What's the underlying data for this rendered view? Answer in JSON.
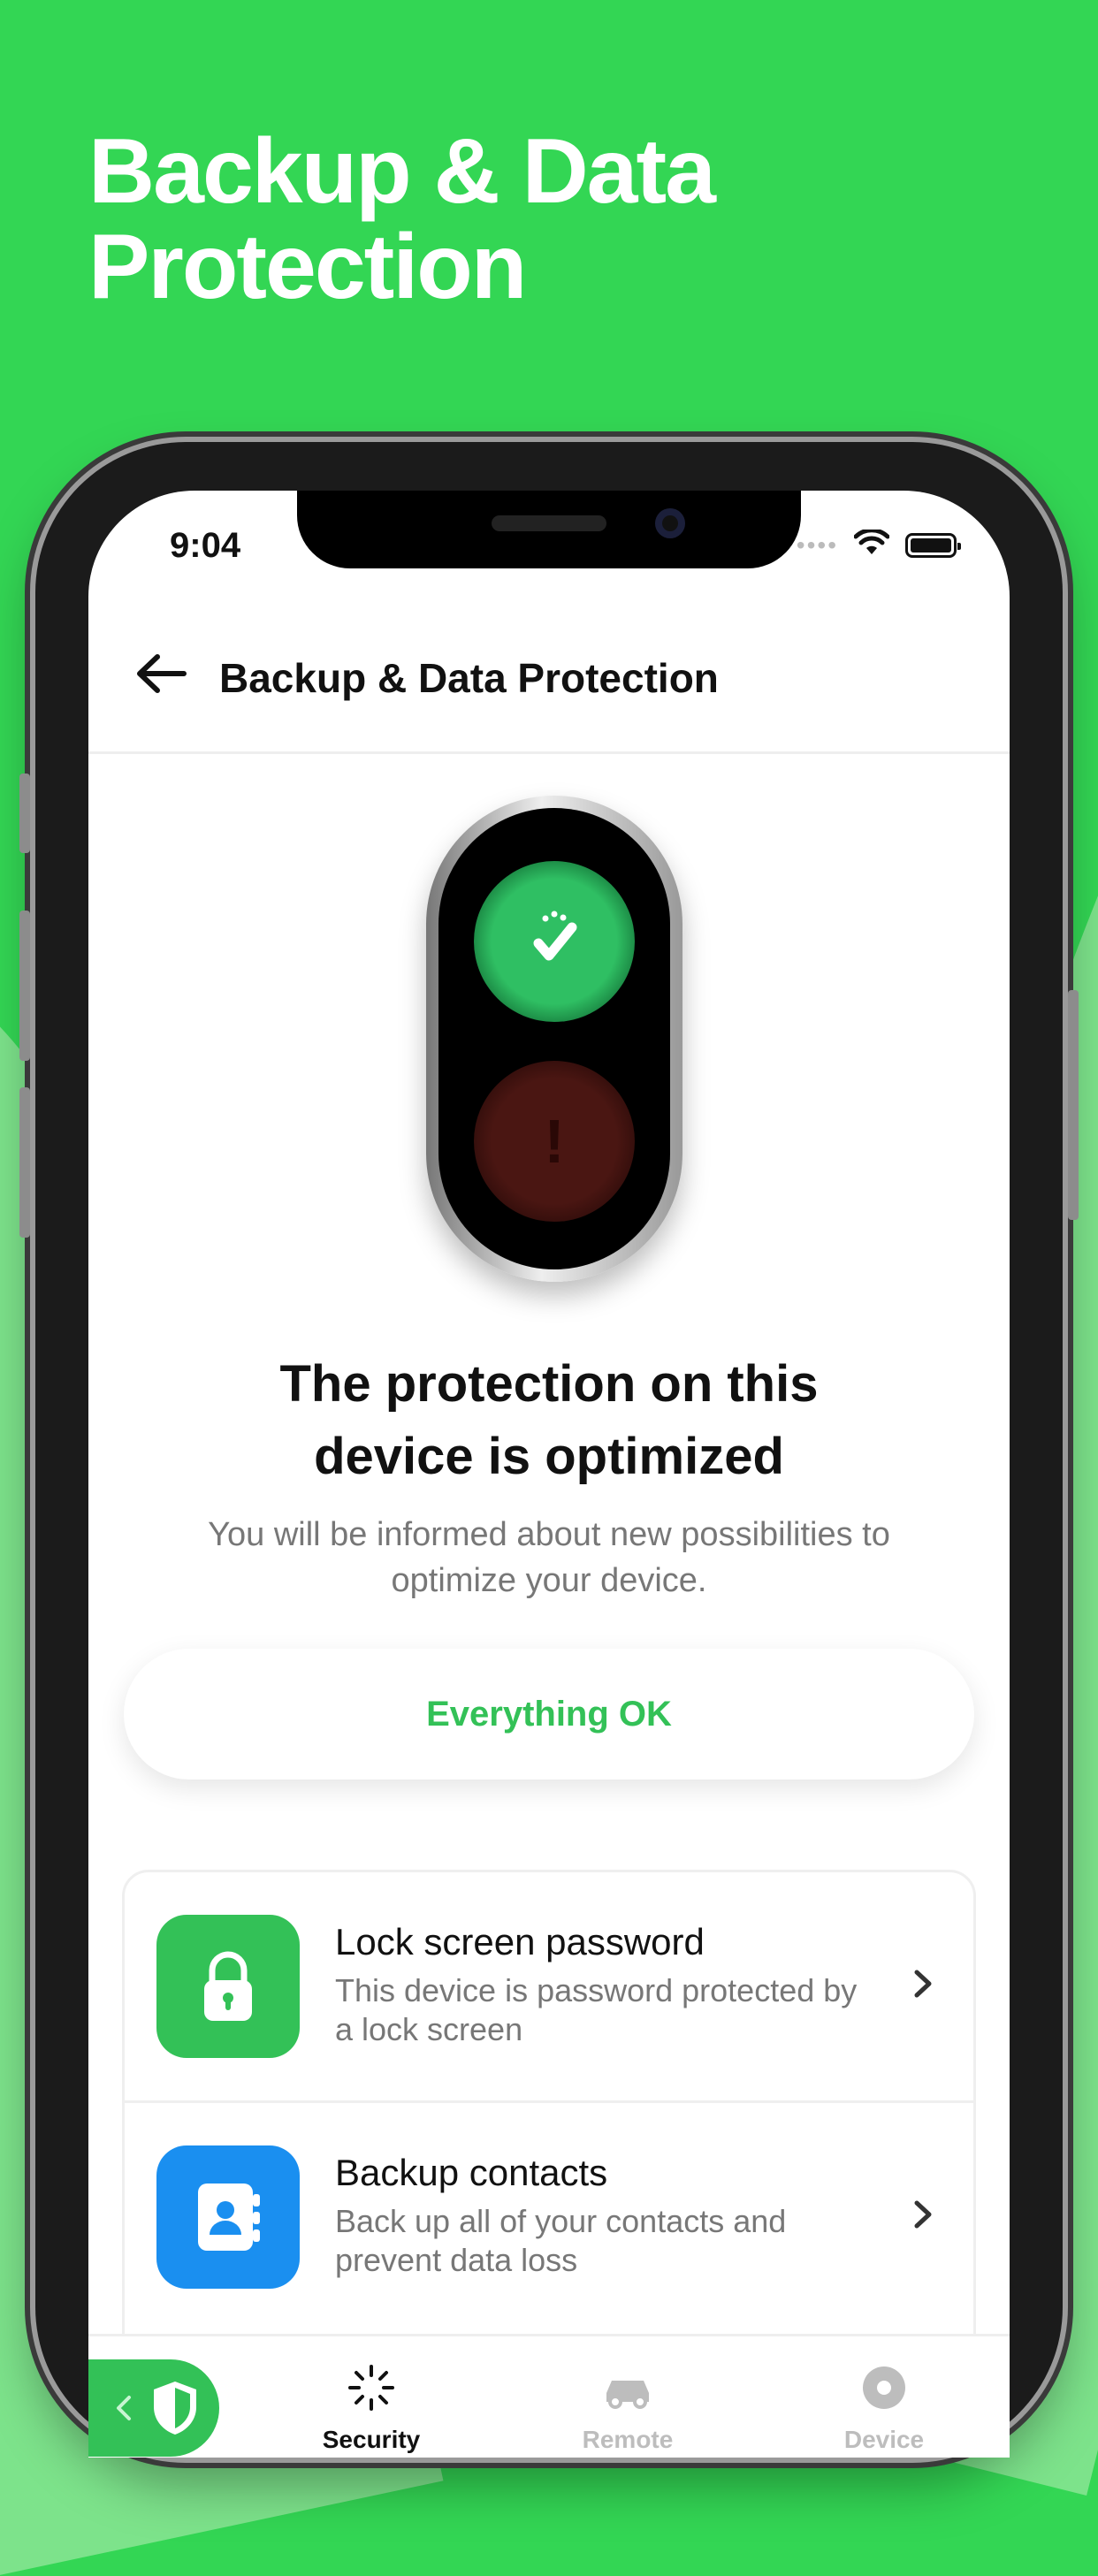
{
  "banner": {
    "title_line1": "Backup & Data",
    "title_line2": "Protection"
  },
  "status_bar": {
    "time": "9:04"
  },
  "navbar": {
    "title": "Backup & Data Protection"
  },
  "status_card": {
    "headline_line1": "The protection on this",
    "headline_line2": "device is optimized",
    "description": "You will be informed about new possibilities to optimize your device.",
    "button_label": "Everything OK",
    "red_light_symbol": "!"
  },
  "items": [
    {
      "title": "Lock screen password",
      "description": "This device is password protected by a lock screen",
      "icon": "lock-icon",
      "icon_color": "#33c157"
    },
    {
      "title": "Backup contacts",
      "description": "Back up all of your contacts and prevent data loss",
      "icon": "contacts-icon",
      "icon_color": "#1a8ff0"
    }
  ],
  "tabbar": {
    "tabs": [
      {
        "label": "Security",
        "icon": "spinner-icon",
        "active": true
      },
      {
        "label": "Remote",
        "icon": "car-icon",
        "active": false
      },
      {
        "label": "Device",
        "icon": "device-icon",
        "active": false
      }
    ]
  },
  "colors": {
    "brand_green": "#33d654",
    "accent_green": "#33c157",
    "contacts_blue": "#1a8ff0"
  }
}
